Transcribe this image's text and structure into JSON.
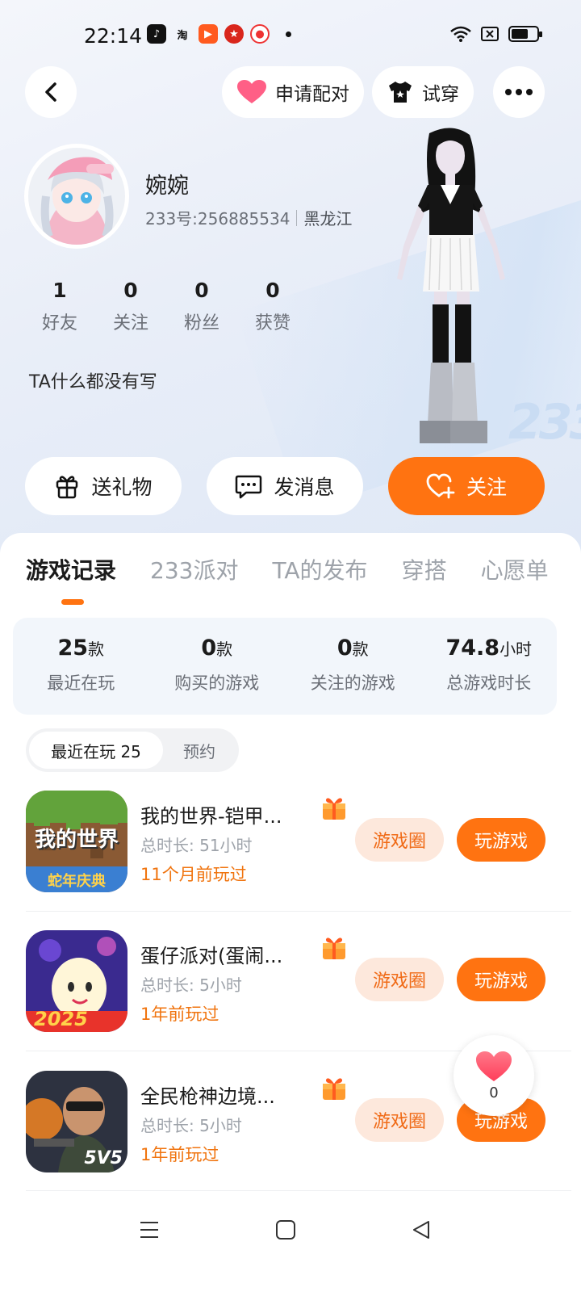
{
  "status_bar": {
    "time": "22:14"
  },
  "header": {
    "match_label": "申请配对",
    "tryon_label": "试穿"
  },
  "profile": {
    "name": "婉婉",
    "id_text": "233号:256885534",
    "region": "黑龙江",
    "stats": [
      {
        "value": "1",
        "label": "好友"
      },
      {
        "value": "0",
        "label": "关注"
      },
      {
        "value": "0",
        "label": "粉丝"
      },
      {
        "value": "0",
        "label": "获赞"
      }
    ],
    "bio": "TA什么都没有写",
    "badge": "233"
  },
  "actions": {
    "gift": "送礼物",
    "message": "发消息",
    "follow": "关注"
  },
  "tabs": [
    "游戏记录",
    "233派对",
    "TA的发布",
    "穿搭",
    "心愿单"
  ],
  "summary": [
    {
      "value": "25",
      "unit": "款",
      "label": "最近在玩"
    },
    {
      "value": "0",
      "unit": "款",
      "label": "购买的游戏"
    },
    {
      "value": "0",
      "unit": "款",
      "label": "关注的游戏"
    },
    {
      "value": "74.8",
      "unit": "小时",
      "label": "总游戏时长"
    }
  ],
  "segment": {
    "recent": "最近在玩 25",
    "reserve": "预约"
  },
  "games": [
    {
      "title": "我的世界-铠甲...",
      "duration": "总时长:  51小时",
      "last_played": "11个月前玩过",
      "circle_btn": "游戏圈",
      "play_btn": "玩游戏",
      "icon_text": "我的世界",
      "icon_sub": "蛇年庆典"
    },
    {
      "title": "蛋仔派对(蛋闹...",
      "duration": "总时长:  5小时",
      "last_played": "1年前玩过",
      "circle_btn": "游戏圈",
      "play_btn": "玩游戏",
      "icon_text": "2025"
    },
    {
      "title": "全民枪神边境...",
      "duration": "总时长:  5小时",
      "last_played": "1年前玩过",
      "circle_btn": "游戏圈",
      "play_btn": "玩游戏",
      "icon_text": "5V5"
    }
  ],
  "like": {
    "count": "0"
  },
  "colors": {
    "accent": "#ff7311",
    "accent_light": "#fde8dc",
    "summary_bg": "#f2f6fb"
  }
}
